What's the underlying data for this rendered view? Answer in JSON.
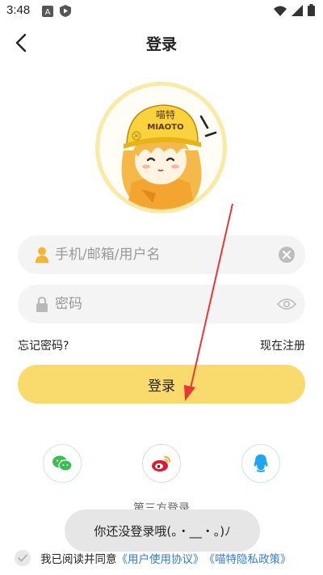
{
  "status_bar": {
    "time": "3:48",
    "left_icons": [
      "android-a-icon",
      "shield-play-icon"
    ],
    "right_icons": [
      "wifi-icon",
      "signal-icon",
      "battery-icon"
    ]
  },
  "header": {
    "title": "登录",
    "back_icon": "back-arrow-icon"
  },
  "avatar": {
    "helmet_text": "喵特",
    "helmet_subtext": "MIAOTO"
  },
  "form": {
    "username_placeholder": "手机/邮箱/用户名",
    "username_value": "",
    "password_placeholder": "密码",
    "password_value": ""
  },
  "links": {
    "forgot": "忘记密码?",
    "register": "现在注册"
  },
  "login_button": "登录",
  "social": {
    "label": "第三方登录",
    "items": [
      "wechat",
      "weibo",
      "qq"
    ]
  },
  "toast": "你还没登录哦(。・__・。)ﾉ",
  "agreement": {
    "prefix": "我已阅读并同意",
    "terms": "《用户使用协议》",
    "privacy": "《喵特隐私政策》"
  },
  "colors": {
    "accent_yellow": "#f9db6d",
    "avatar_ring": "#fbe9a6",
    "link_blue": "#3a7bd5",
    "annotation_red": "#e53935",
    "wechat_green": "#3bbd54",
    "weibo_red": "#e6162d",
    "qq_blue": "#1ea7f0"
  }
}
